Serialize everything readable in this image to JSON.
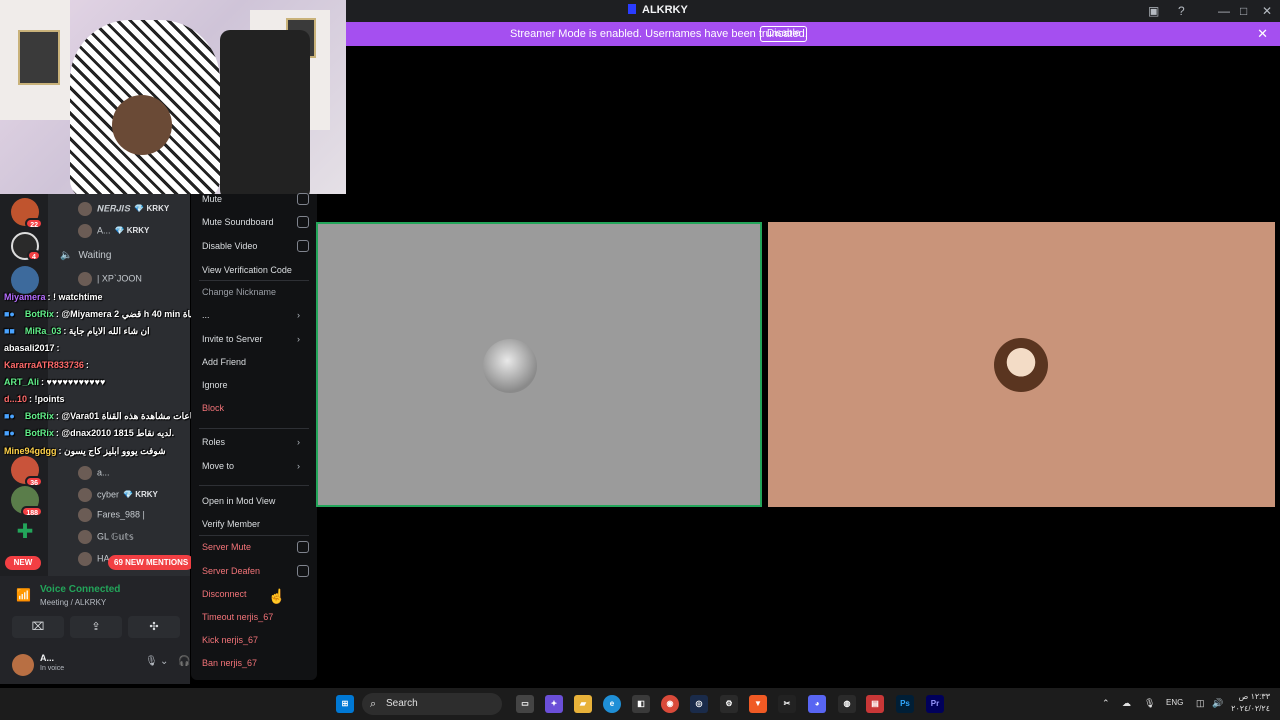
{
  "window": {
    "title": "ALKRKY"
  },
  "banner": {
    "message": "Streamer Mode is enabled. Usernames have been truncated.",
    "button": "Disable"
  },
  "servers": {
    "badges": [
      "22",
      "4",
      "36",
      "188"
    ],
    "new_label": "NEW"
  },
  "channel": {
    "voice_users": [
      {
        "name": "𝑵𝑬𝑹𝑱𝑰𝑺",
        "tag": "KRKY"
      },
      {
        "name": "A...",
        "tag": "KRKY"
      },
      {
        "name": "Waiting",
        "tag": ""
      },
      {
        "name": "| XP`JOON",
        "tag": ""
      },
      {
        "name": "a...",
        "tag": ""
      },
      {
        "name": "cyber",
        "tag": "KRKY"
      },
      {
        "name": "Fares_988 |",
        "tag": ""
      },
      {
        "name": "GL 𝔾𝕦𝕥𝕤",
        "tag": ""
      },
      {
        "name": "HA...",
        "tag": ""
      }
    ],
    "mentions": "69 NEW MENTIONS"
  },
  "chat": [
    {
      "user": "Miyamera",
      "text": ": ! watchtime",
      "color": "#b56cff"
    },
    {
      "user": "BotRix",
      "text": ": @Miyamera 2 قضي h 40 min مشاهدة هذه القناة.",
      "color": "#62f08a"
    },
    {
      "user": "MiRa_03",
      "text": ": ان شاء الله الايام جاية",
      "color": "#62f08a"
    },
    {
      "user": "abasali2017",
      "text": ":",
      "color": "#ffffff"
    },
    {
      "user": "KararraATR833736",
      "text": ":",
      "color": "#ff6a6a"
    },
    {
      "user": "ART_Ali",
      "text": ": ♥♥♥♥♥♥♥♥♥♥♥",
      "color": "#62f08a"
    },
    {
      "user": "d...10",
      "text": ": !points",
      "color": "#ff6a6a"
    },
    {
      "user": "BotRix",
      "text": ": @Vara01 قضي 1 أشهر 8 أيام 16 ساعات مشاهدة هذه القناة.",
      "color": "#62f08a"
    },
    {
      "user": "BotRix",
      "text": ": @dnax2010 1815 لديه نقاط.",
      "color": "#62f08a"
    },
    {
      "user": "Mine94gdgg",
      "text": ": شوفت يووو ابليز كاج يسون",
      "color": "#ffd24a"
    }
  ],
  "voice_panel": {
    "status": "Voice Connected",
    "channel": "Meeting / ALKRKY",
    "user_name": "A...",
    "user_status": "In voice"
  },
  "menu": {
    "items": [
      {
        "label": "Mute",
        "kind": "check",
        "style": ""
      },
      {
        "label": "Mute Soundboard",
        "kind": "check",
        "style": ""
      },
      {
        "label": "Disable Video",
        "kind": "check",
        "style": ""
      },
      {
        "label": "View Verification Code",
        "kind": "",
        "style": ""
      },
      {
        "label": "Change Nickname",
        "kind": "",
        "style": "dim"
      },
      {
        "label": "...",
        "kind": "sub",
        "style": ""
      },
      {
        "label": "Invite to Server",
        "kind": "sub",
        "style": ""
      },
      {
        "label": "Add Friend",
        "kind": "",
        "style": ""
      },
      {
        "label": "Ignore",
        "kind": "",
        "style": ""
      },
      {
        "label": "Block",
        "kind": "",
        "style": "red"
      },
      {
        "label": "Roles",
        "kind": "sub",
        "style": ""
      },
      {
        "label": "Move to",
        "kind": "sub",
        "style": ""
      },
      {
        "label": "Open in Mod View",
        "kind": "",
        "style": ""
      },
      {
        "label": "Verify Member",
        "kind": "",
        "style": ""
      },
      {
        "label": "Server Mute",
        "kind": "check",
        "style": "red"
      },
      {
        "label": "Server Deafen",
        "kind": "check",
        "style": "red"
      },
      {
        "label": "Disconnect",
        "kind": "",
        "style": "red"
      },
      {
        "label": "Timeout nerjis_67",
        "kind": "",
        "style": "red"
      },
      {
        "label": "Kick nerjis_67",
        "kind": "",
        "style": "red"
      },
      {
        "label": "Ban nerjis_67",
        "kind": "",
        "style": "red"
      }
    ]
  },
  "taskbar": {
    "search": "Search",
    "lang": "ENG",
    "time": "١٢:٣٣ ص",
    "date": "٢٠٢٤/٠٢/٢٤"
  }
}
